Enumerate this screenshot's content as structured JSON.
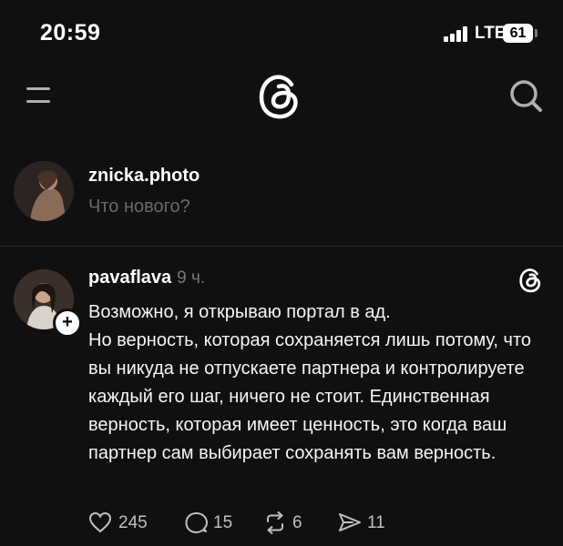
{
  "status_bar": {
    "time": "20:59",
    "network": "LTE",
    "battery": "61"
  },
  "nav": {
    "logo_icon": "threads-logo-icon",
    "menu_icon": "menu-icon",
    "search_icon": "search-icon"
  },
  "compose": {
    "username": "znicka.photo",
    "placeholder": "Что нового?"
  },
  "post": {
    "author": "pavaflava",
    "time": "9 ч.",
    "paragraphs": [
      "Возможно, я открываю портал в ад.",
      "Но верность, которая сохраняется лишь потому, что вы никуда не отпускаете партнера и контролируете каждый его шаг, ничего не стоит. Единственная верность, которая имеет ценность, это когда ваш партнер сам выбирает сохранять вам верность."
    ],
    "likes": "245",
    "replies": "15",
    "reposts": "6",
    "shares": "11"
  },
  "colors": {
    "background": "#101010",
    "text": "#f3f5f7",
    "muted": "#777777"
  }
}
